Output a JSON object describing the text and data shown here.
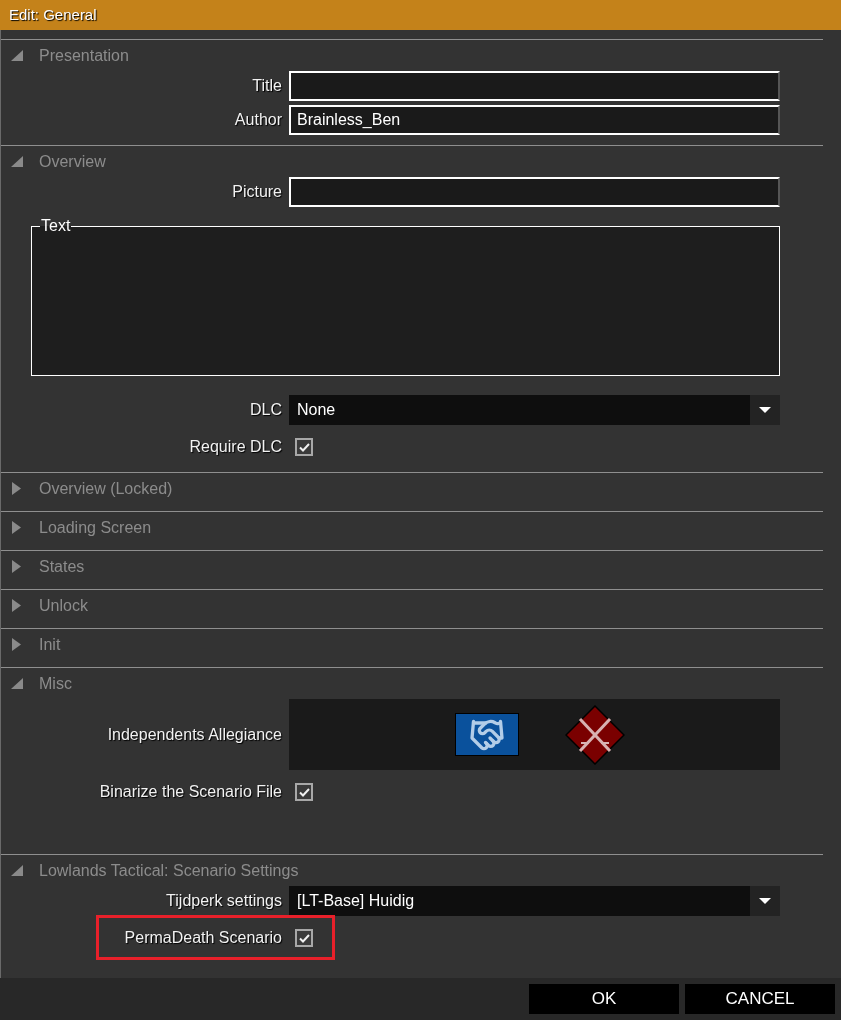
{
  "window": {
    "title": "Edit: General"
  },
  "sections": [
    {
      "title": "Presentation",
      "expanded": true,
      "fields": [
        {
          "kind": "text",
          "label": "Title"
        },
        {
          "kind": "text",
          "label": "Author",
          "value": "Brainless_Ben"
        }
      ]
    },
    {
      "title": "Overview",
      "expanded": true,
      "fields": [
        {
          "kind": "text",
          "label": "Picture"
        },
        {
          "kind": "textarea",
          "label": "Text"
        },
        {
          "kind": "dropdown",
          "label": "DLC",
          "value": "None"
        },
        {
          "kind": "checkbox",
          "label": "Require DLC",
          "checked": true
        }
      ]
    },
    {
      "title": "Overview (Locked)",
      "expanded": false
    },
    {
      "title": "Loading Screen",
      "expanded": false
    },
    {
      "title": "States",
      "expanded": false
    },
    {
      "title": "Unlock",
      "expanded": false
    },
    {
      "title": "Init",
      "expanded": false
    },
    {
      "title": "Misc",
      "expanded": true,
      "fields": [
        {
          "kind": "allegiance",
          "label": "Independents Allegiance"
        },
        {
          "kind": "checkbox",
          "label": "Binarize the Scenario File",
          "checked": true
        }
      ]
    },
    {
      "title": "Lowlands Tactical: Scenario Settings",
      "expanded": true,
      "fields": [
        {
          "kind": "dropdown",
          "label": "Tijdperk settings",
          "value": "[LT-Base] Huidig"
        },
        {
          "kind": "checkbox",
          "label": "PermaDeath Scenario",
          "checked": true,
          "highlighted": true
        }
      ]
    }
  ],
  "buttons": [
    "OK",
    "CANCEL"
  ]
}
